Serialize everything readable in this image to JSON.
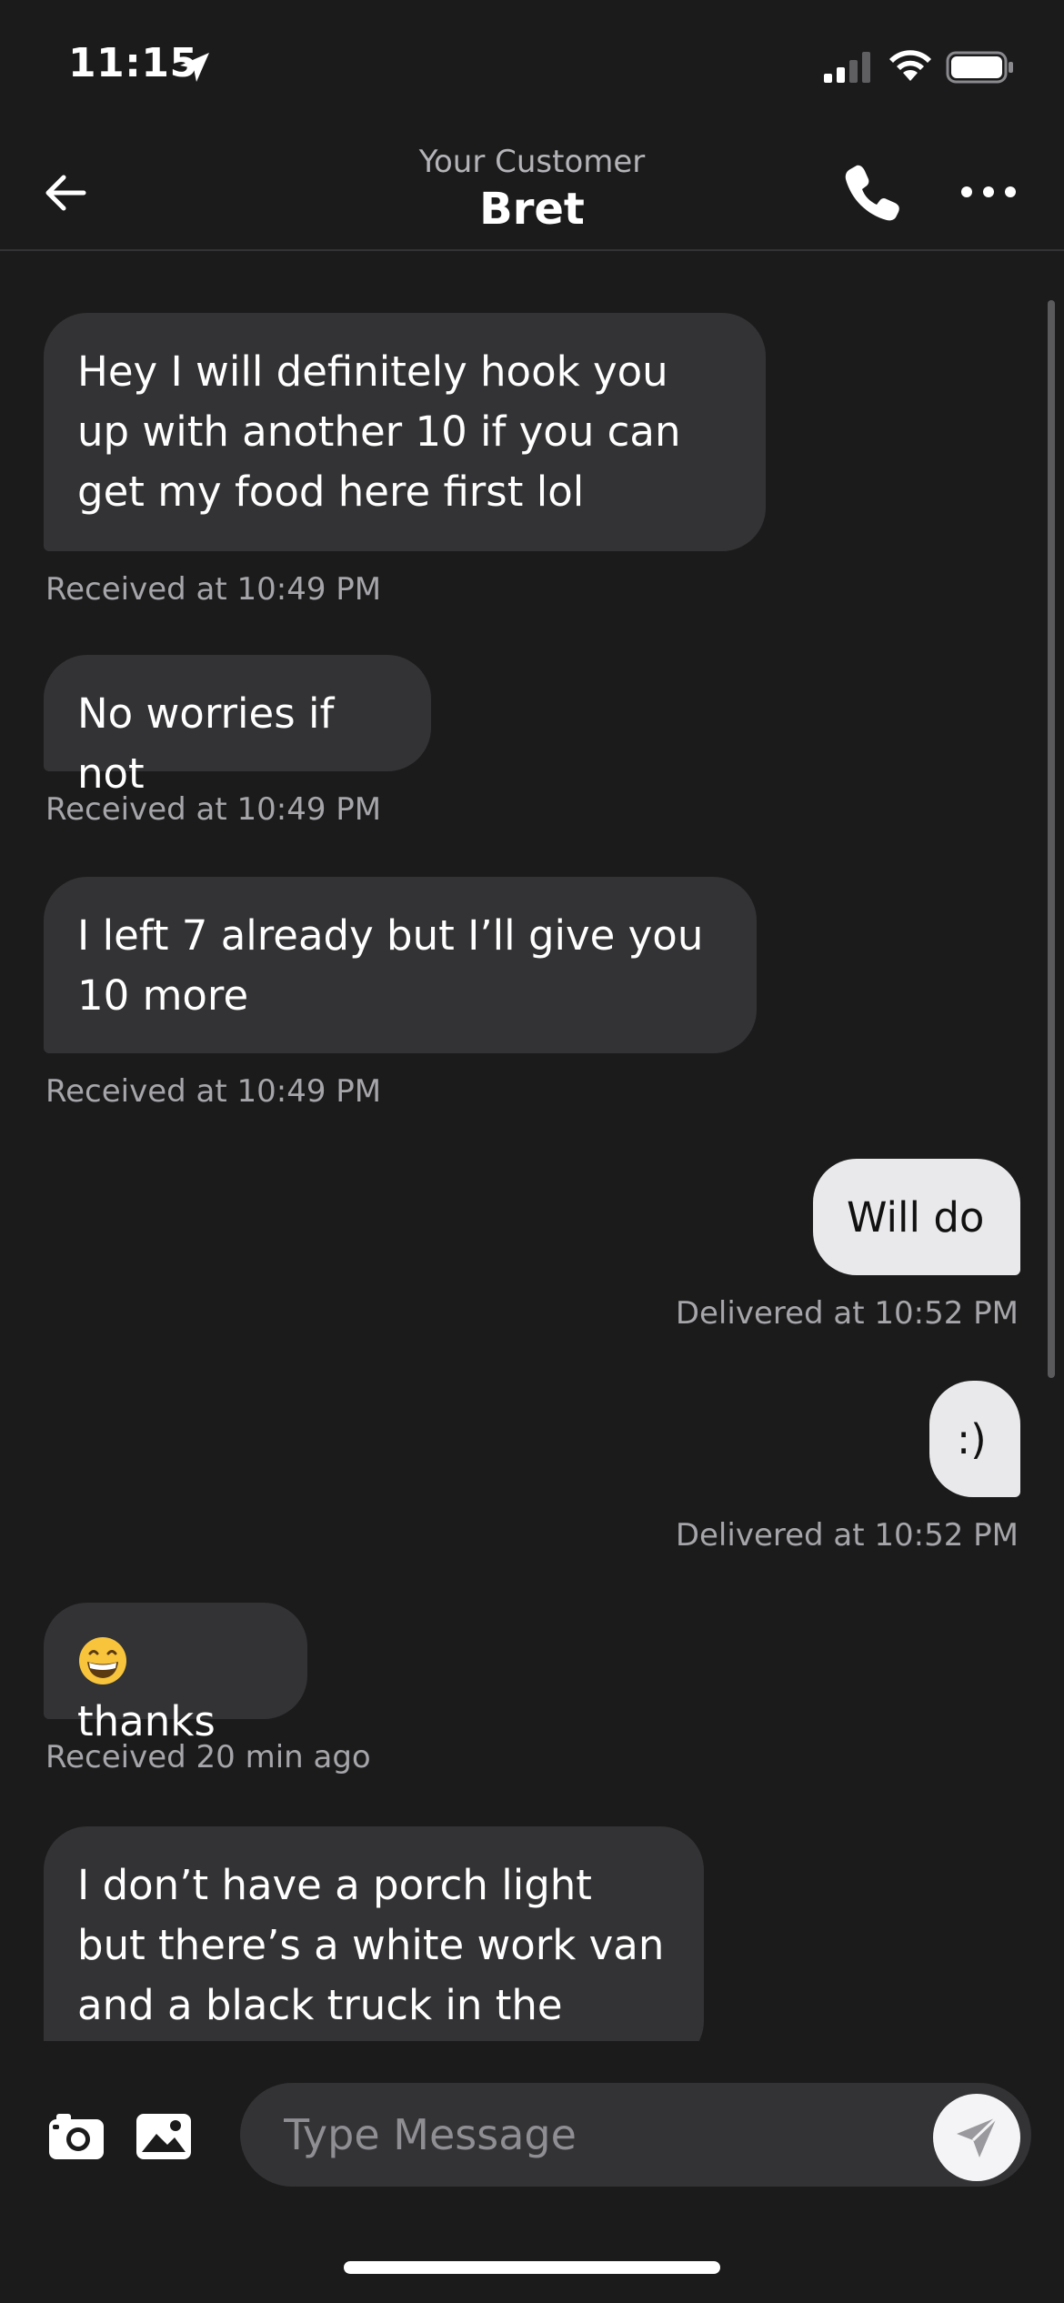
{
  "status_bar": {
    "time": "11:15"
  },
  "header": {
    "subtitle": "Your Customer",
    "title": "Bret"
  },
  "messages": [
    {
      "direction": "in",
      "text": "Hey I will definitely hook you up with another 10 if you can get my food here first lol",
      "meta": "Received at 10:49 PM"
    },
    {
      "direction": "in",
      "text": "No worries if not",
      "meta": "Received at 10:49 PM"
    },
    {
      "direction": "in",
      "text": "I left 7 already but I’ll give you 10 more",
      "meta": "Received at 10:49 PM"
    },
    {
      "direction": "out",
      "text": "Will do",
      "meta": "Delivered at 10:52 PM"
    },
    {
      "direction": "out",
      "text": ":)",
      "meta": "Delivered at 10:52 PM"
    },
    {
      "direction": "in",
      "text": "thanks",
      "emoji": "grinning-face",
      "meta": "Received 20 min ago"
    },
    {
      "direction": "in",
      "text": "I don’t have a porch light but there’s a white work van and a black truck in the driveway",
      "meta": ""
    }
  ],
  "input": {
    "placeholder": "Type Message"
  },
  "colors": {
    "background": "#1b1b1c",
    "incoming_bubble": "#333335",
    "outgoing_bubble": "#e9e9eb",
    "meta_text": "#a6a6aa"
  }
}
